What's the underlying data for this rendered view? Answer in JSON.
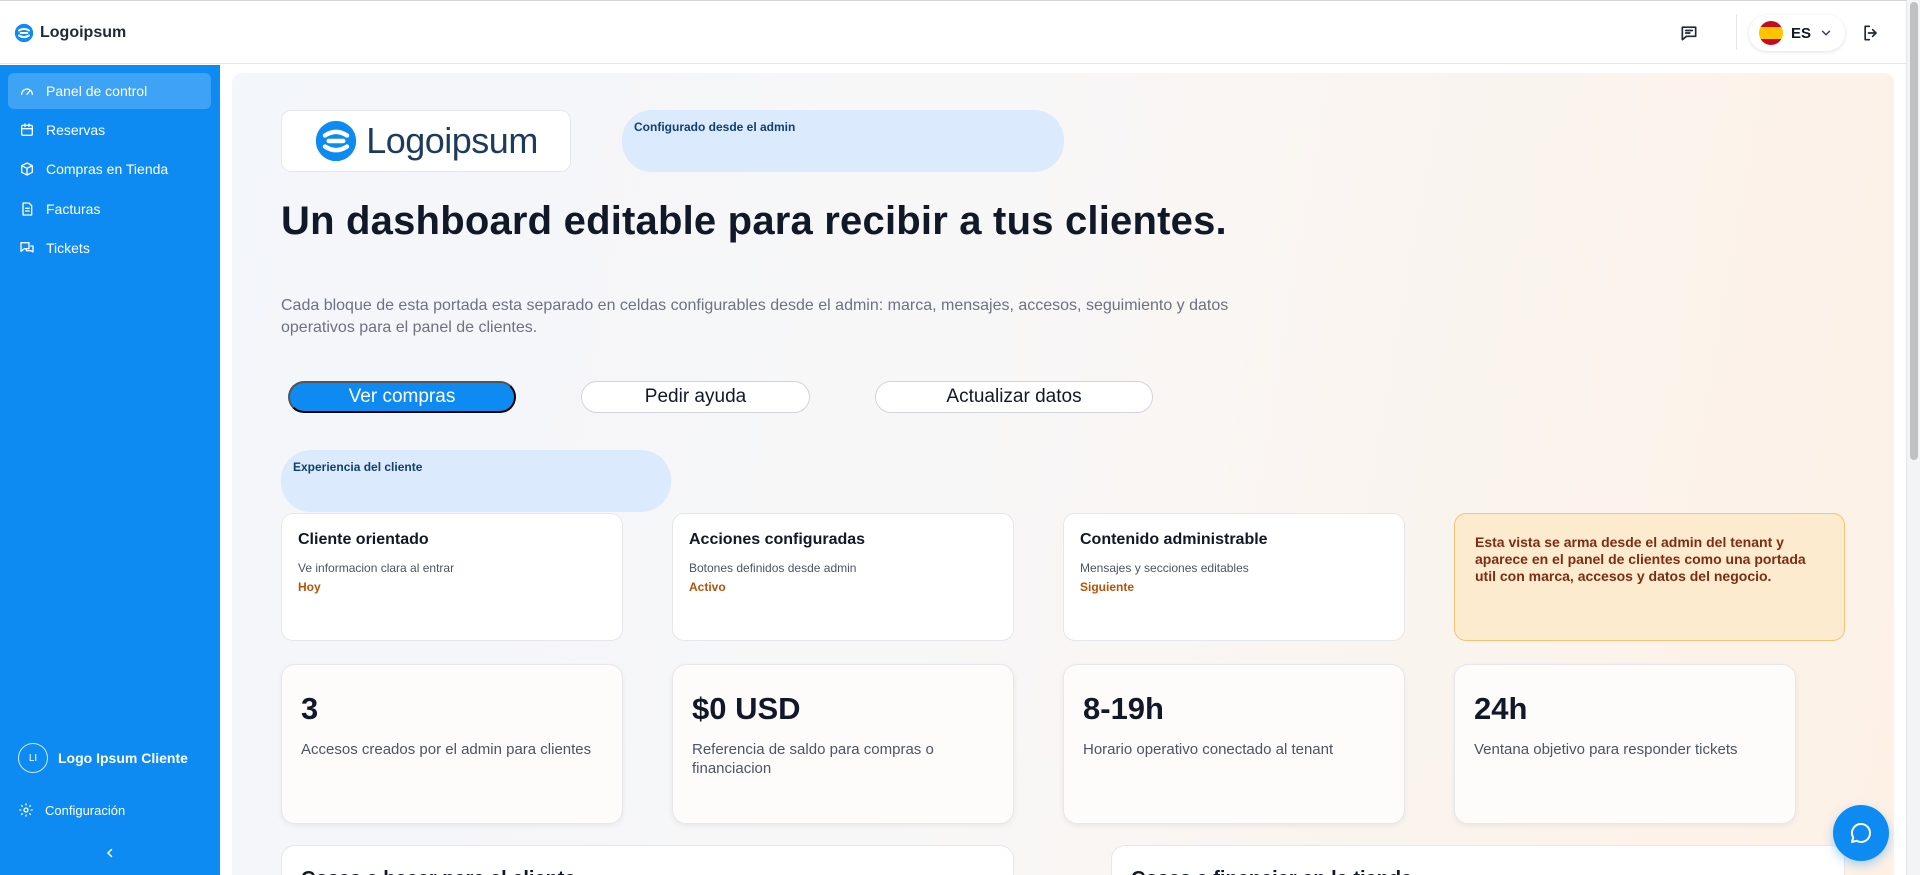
{
  "header": {
    "brand_name": "Logoipsum",
    "language_code": "ES",
    "icons": [
      "chat-icon",
      "flag-es-icon",
      "chevron-down-icon",
      "logout-icon"
    ]
  },
  "sidebar": {
    "items": [
      {
        "label": "Panel de control",
        "icon": "gauge-icon",
        "active": true
      },
      {
        "label": "Reservas",
        "icon": "calendar-icon",
        "active": false
      },
      {
        "label": "Compras en Tienda",
        "icon": "box-icon",
        "active": false
      },
      {
        "label": "Facturas",
        "icon": "file-icon",
        "active": false
      },
      {
        "label": "Tickets",
        "icon": "messages-icon",
        "active": false
      }
    ],
    "user": {
      "initials": "LI",
      "name": "Logo Ipsum Cliente"
    },
    "settings_label": "Configuración",
    "collapse_icon": "chevron-left-icon"
  },
  "main": {
    "logo_text": "Logoipsum",
    "config_pill": "Configurado desde el admin",
    "headline": "Un dashboard editable para recibir a tus clientes.",
    "description": "Cada bloque de esta portada esta separado en celdas configurables desde el admin: marca, mensajes, accesos, seguimiento y datos operativos para el panel de clientes.",
    "buttons": {
      "primary": "Ver compras",
      "help": "Pedir ayuda",
      "update": "Actualizar datos"
    },
    "experience_pill": "Experiencia del cliente",
    "info_cards": [
      {
        "title": "Cliente orientado",
        "subtitle": "Ve informacion clara al entrar",
        "status": "Hoy"
      },
      {
        "title": "Acciones configuradas",
        "subtitle": "Botones definidos desde admin",
        "status": "Activo"
      },
      {
        "title": "Contenido administrable",
        "subtitle": "Mensajes y secciones editables",
        "status": "Siguiente"
      }
    ],
    "note": "Esta vista se arma desde el admin del tenant y aparece en el panel de clientes como una portada util con marca, accesos y datos del negocio.",
    "stats": [
      {
        "value": "3",
        "label": "Accesos creados por el admin para clientes"
      },
      {
        "value": "$0 USD",
        "label": "Referencia de saldo para compras o financiacion"
      },
      {
        "value": "8-19h",
        "label": "Horario operativo conectado al tenant"
      },
      {
        "value": "24h",
        "label": "Ventana objetivo para responder tickets"
      }
    ],
    "bottom_cards": [
      {
        "title": "Cosas a hacer para el cliente"
      },
      {
        "title": "Cosas a financiar en la tienda"
      }
    ]
  },
  "colors": {
    "accent": "#0d8bf2",
    "sidebar_bg": "#0d8bf2",
    "pill_bg": "#dbeafd",
    "status_text": "#b45309",
    "note_bg": "#fdebd0",
    "note_text": "#7c2d12"
  }
}
